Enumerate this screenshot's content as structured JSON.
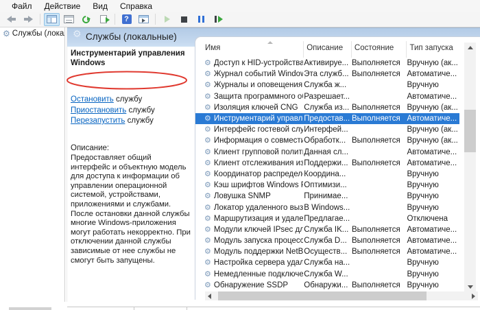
{
  "menu": {
    "items": [
      {
        "id": "file",
        "label": "Файл"
      },
      {
        "id": "action",
        "label": "Действие"
      },
      {
        "id": "view",
        "label": "Вид"
      },
      {
        "id": "help",
        "label": "Справка"
      }
    ]
  },
  "toolbar": {
    "groups": [
      [
        {
          "name": "back-icon",
          "shape": "back"
        },
        {
          "name": "forward-icon",
          "shape": "fwd"
        }
      ],
      [
        {
          "name": "show-console-tree-icon",
          "shape": "wintree",
          "selected": true
        },
        {
          "name": "properties-icon",
          "shape": "winform"
        },
        {
          "name": "refresh-icon",
          "shape": "refresh"
        },
        {
          "name": "export-list-icon",
          "shape": "export"
        }
      ],
      [
        {
          "name": "help-icon",
          "shape": "help"
        },
        {
          "name": "show-action-pane-icon",
          "shape": "winplay"
        }
      ],
      [
        {
          "name": "start-service-icon",
          "shape": "play"
        },
        {
          "name": "stop-service-icon",
          "shape": "stop"
        },
        {
          "name": "pause-service-icon",
          "shape": "pause"
        },
        {
          "name": "restart-service-icon",
          "shape": "restart"
        }
      ]
    ]
  },
  "tree": {
    "items": [
      {
        "id": "services-local",
        "label": "Службы (локальные)"
      }
    ]
  },
  "panel": {
    "title": "Службы (локальные)",
    "service_name": "Инструментарий управления Windows",
    "actions": [
      {
        "id": "stop-service-link",
        "link": "Остановить",
        "rest": "службу",
        "circled": true
      },
      {
        "id": "pause-service-link",
        "link": "Приостановить",
        "rest": "службу"
      },
      {
        "id": "restart-service-link",
        "link": "Перезапустить",
        "rest": "службу"
      }
    ],
    "description_label": "Описание:",
    "description": "Предоставляет общий интерфейс и объектную модель для доступа к информации об управлении операционной системой, устройствами, приложениями и службами. После остановки данной службы многие Windows-приложения могут работать некорректно. При отключении данной службы зависимые от нее службы не смогут быть запущены.",
    "annotation_color": "#e0392f"
  },
  "services": {
    "columns": [
      {
        "id": "name",
        "label": "Имя"
      },
      {
        "id": "description",
        "label": "Описание"
      },
      {
        "id": "status",
        "label": "Состояние"
      },
      {
        "id": "startup",
        "label": "Тип запуска"
      }
    ],
    "sorted_by": "name",
    "selected_index": 5,
    "rows": [
      {
        "name": "Доступ к HID-устройствам",
        "desc": "Активируе...",
        "status": "Выполняется",
        "startup": "Вручную (ак..."
      },
      {
        "name": "Журнал событий Windows",
        "desc": "Эта служб...",
        "status": "Выполняется",
        "startup": "Автоматиче..."
      },
      {
        "name": "Журналы и оповещения п...",
        "desc": "Служба ж...",
        "status": "",
        "startup": "Вручную"
      },
      {
        "name": "Защита программного об...",
        "desc": "Разрешает...",
        "status": "",
        "startup": "Автоматиче..."
      },
      {
        "name": "Изоляция ключей CNG",
        "desc": "Служба из...",
        "status": "Выполняется",
        "startup": "Вручную (ак..."
      },
      {
        "name": "Инструментарий управле...",
        "desc": "Предостав...",
        "status": "Выполняется",
        "startup": "Автоматиче..."
      },
      {
        "name": "Интерфейс гостевой служ...",
        "desc": "Интерфей...",
        "status": "",
        "startup": "Вручную (ак..."
      },
      {
        "name": "Информация о совмести...",
        "desc": "Обработк...",
        "status": "Выполняется",
        "startup": "Вручную (ак..."
      },
      {
        "name": "Клиент групповой полити...",
        "desc": "Данная сл...",
        "status": "",
        "startup": "Автоматиче..."
      },
      {
        "name": "Клиент отслеживания изм...",
        "desc": "Поддержи...",
        "status": "Выполняется",
        "startup": "Автоматиче..."
      },
      {
        "name": "Координатор распределен...",
        "desc": "Координа...",
        "status": "",
        "startup": "Вручную"
      },
      {
        "name": "Кэш шрифтов Windows Pr...",
        "desc": "Оптимизи...",
        "status": "",
        "startup": "Вручную"
      },
      {
        "name": "Ловушка SNMP",
        "desc": "Принимае...",
        "status": "",
        "startup": "Вручную"
      },
      {
        "name": "Локатор удаленного вызо...",
        "desc": "В Windows...",
        "status": "",
        "startup": "Вручную"
      },
      {
        "name": "Маршрутизация и удален...",
        "desc": "Предлагае...",
        "status": "",
        "startup": "Отключена"
      },
      {
        "name": "Модули ключей IPsec для ...",
        "desc": "Служба IK...",
        "status": "Выполняется",
        "startup": "Автоматиче..."
      },
      {
        "name": "Модуль запуска процессо...",
        "desc": "Служба D...",
        "status": "Выполняется",
        "startup": "Автоматиче..."
      },
      {
        "name": "Модуль поддержки NetBI...",
        "desc": "Осуществ...",
        "status": "Выполняется",
        "startup": "Автоматиче..."
      },
      {
        "name": "Настройка сервера удален...",
        "desc": "Служба на...",
        "status": "",
        "startup": "Вручную"
      },
      {
        "name": "Немедленные подключен...",
        "desc": "Служба W...",
        "status": "",
        "startup": "Вручную"
      },
      {
        "name": "Обнаружение SSDP",
        "desc": "Обнаружи...",
        "status": "Выполняется",
        "startup": "Вручную"
      }
    ]
  },
  "colors": {
    "selection": "#2a7ad4",
    "link": "#0563c1",
    "gear": "#7d9aba"
  }
}
